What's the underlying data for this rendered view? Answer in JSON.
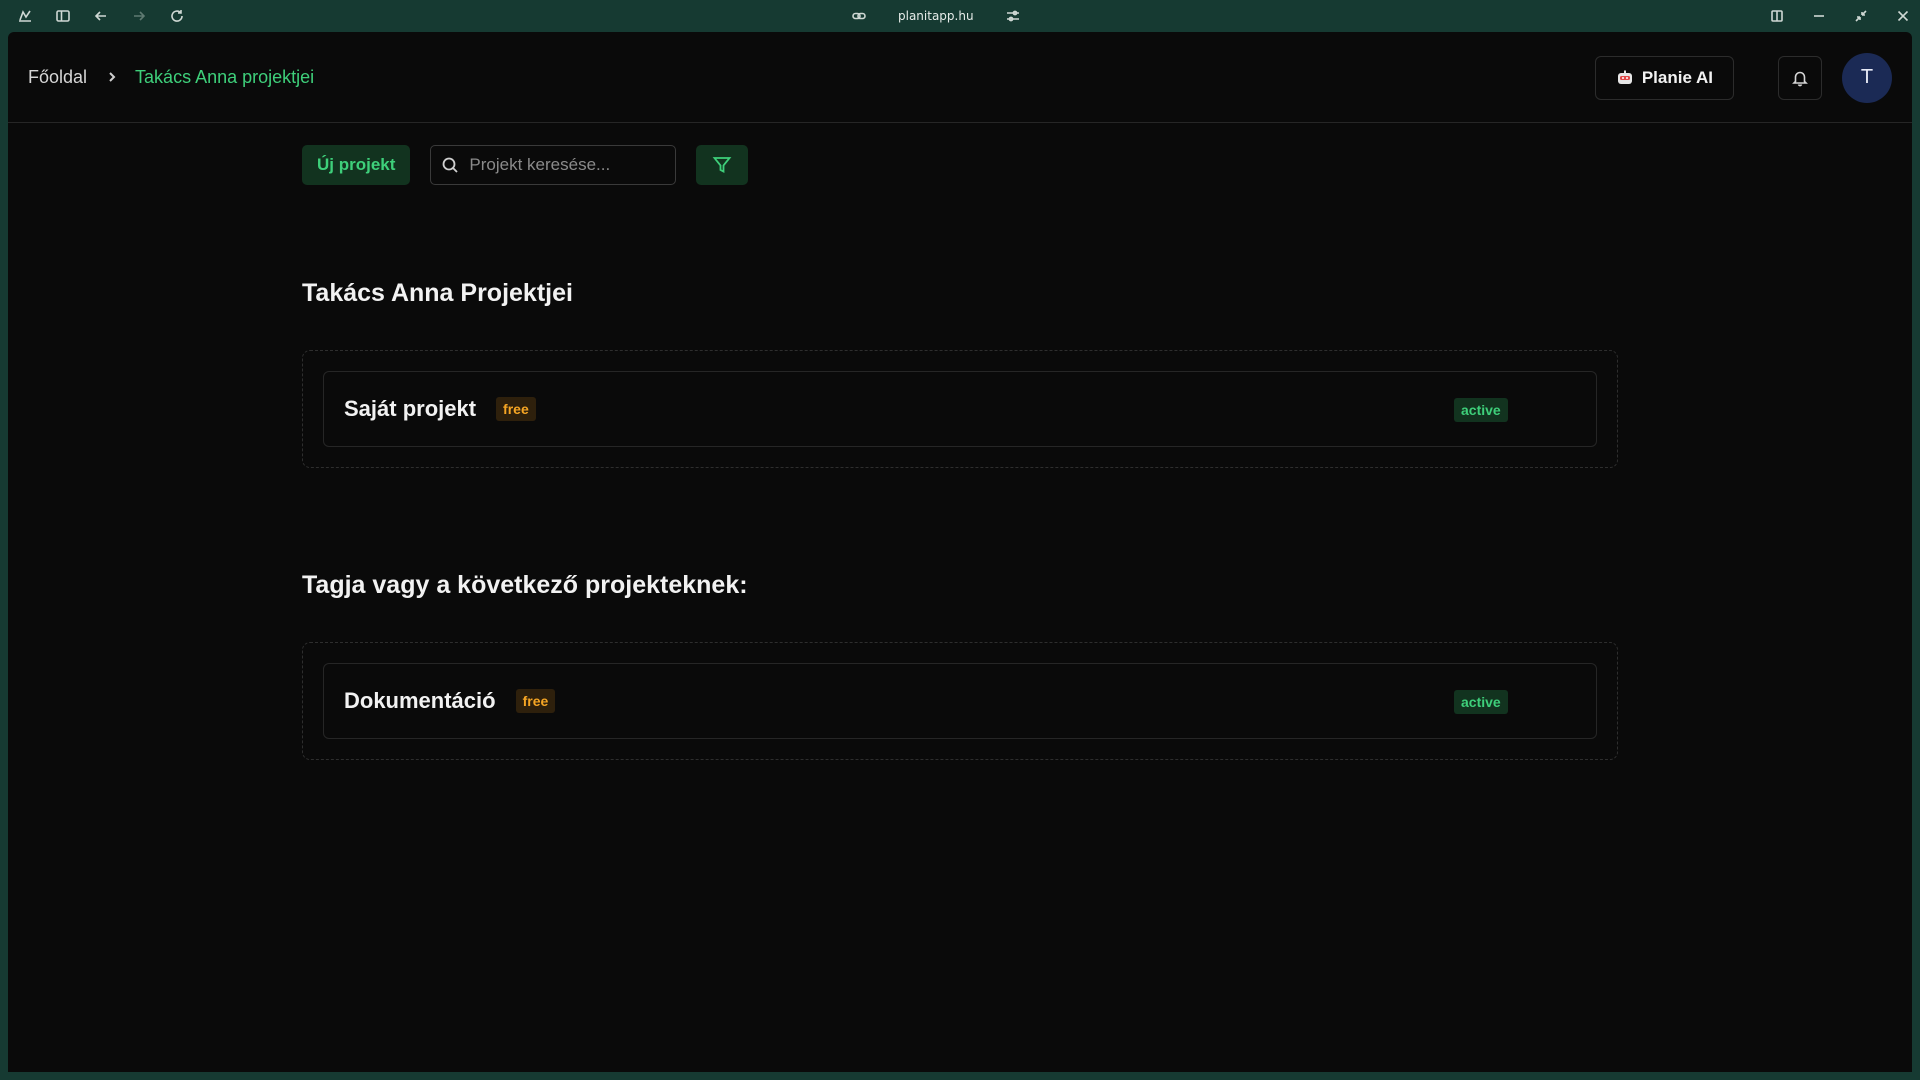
{
  "browser": {
    "url": "planitapp.hu",
    "icons": [
      "extensions-icon",
      "sidebar-toggle-icon",
      "back-arrow-icon",
      "forward-arrow-icon",
      "reload-icon",
      "link-icon",
      "site-settings-icon",
      "split-view-icon",
      "minimize-icon",
      "restore-icon",
      "close-icon"
    ]
  },
  "breadcrumb": {
    "home": "Főoldal",
    "current": "Takács Anna projektjei"
  },
  "header": {
    "ai_button": "Planie AI",
    "avatar_initial": "T"
  },
  "toolbar": {
    "new_project": "Új projekt",
    "search_placeholder": "Projekt keresése..."
  },
  "sections": {
    "own_title": "Takács Anna Projektjei",
    "own_projects": [
      {
        "name": "Saját projekt",
        "plan": "free",
        "status": "active"
      }
    ],
    "member_title": "Tagja vagy a következő projekteknek:",
    "member_projects": [
      {
        "name": "Dokumentáció",
        "plan": "free",
        "status": "active"
      }
    ]
  },
  "colors": {
    "accent_green": "#3ecf7a",
    "badge_amber": "#f5a524",
    "chrome_bg": "#163a32",
    "app_bg": "#0a0a0a",
    "avatar_bg": "#1b2a55"
  }
}
